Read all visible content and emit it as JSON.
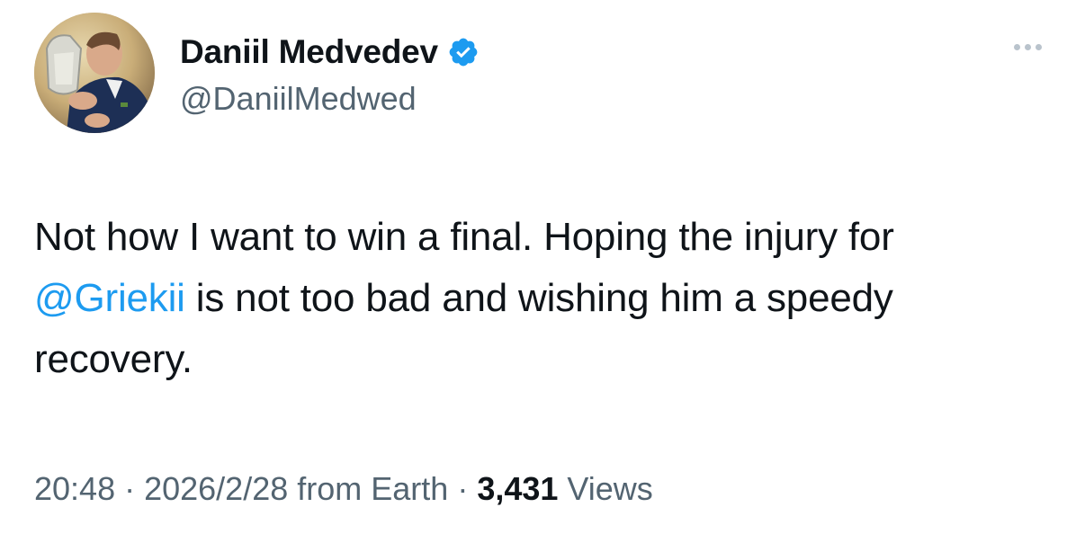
{
  "tweet": {
    "author": {
      "display_name": "Daniil Medvedev",
      "handle": "@DaniilMedwed",
      "verified": true,
      "avatar_icon": "profile-photo"
    },
    "more_icon": "more-horizontal-icon",
    "text": {
      "part1": "Not how I want to win a final.  Hoping the injury for ",
      "mention": "@Griekii",
      "part2": " is not too bad and wishing him a speedy recovery."
    },
    "meta": {
      "time": "20:48",
      "separator": " · ",
      "date": "2026/2/28",
      "source": " from Earth",
      "views_count": "3,431",
      "views_label": " Views"
    },
    "colors": {
      "mention": "#1d9bf0",
      "verified": "#1d9bf0",
      "secondary_text": "#536471",
      "primary_text": "#0f1419"
    }
  }
}
